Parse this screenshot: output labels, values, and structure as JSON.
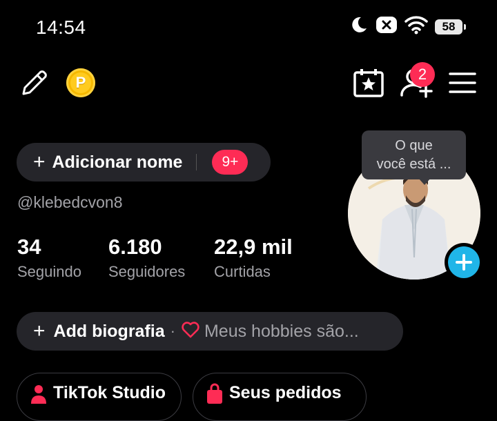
{
  "status_bar": {
    "time": "14:54",
    "battery": "58",
    "icons": [
      "moon-icon",
      "notification-x-icon",
      "wifi-icon",
      "battery-icon"
    ]
  },
  "toolbar": {
    "icons": [
      "pencil-icon",
      "coin-icon",
      "calendar-star-icon",
      "add-friend-icon",
      "menu-icon"
    ],
    "coin_letter": "P",
    "friend_requests_badge": "2"
  },
  "profile": {
    "add_name_label": "Adicionar nome",
    "notification_badge": "9+",
    "username": "@klebedcvon8",
    "stats": [
      {
        "value": "34",
        "label": "Seguindo"
      },
      {
        "value": "6.180",
        "label": "Seguidores"
      },
      {
        "value": "22,9 mil",
        "label": "Curtidas"
      }
    ],
    "avatar_tooltip_line1": "O que",
    "avatar_tooltip_line2": "você está ...",
    "bio_label": "Add biografia",
    "bio_separator": "·",
    "bio_placeholder": "Meus hobbies são..."
  },
  "chips": [
    {
      "label": "TikTok Studio"
    },
    {
      "label": "Seus pedidos"
    }
  ],
  "colors": {
    "background": "#000000",
    "pill": "#25252a",
    "accent_red": "#fe2c55",
    "accent_blue": "#20b5e8",
    "coin": "#f5b800",
    "muted_text": "#a3a3a8"
  }
}
